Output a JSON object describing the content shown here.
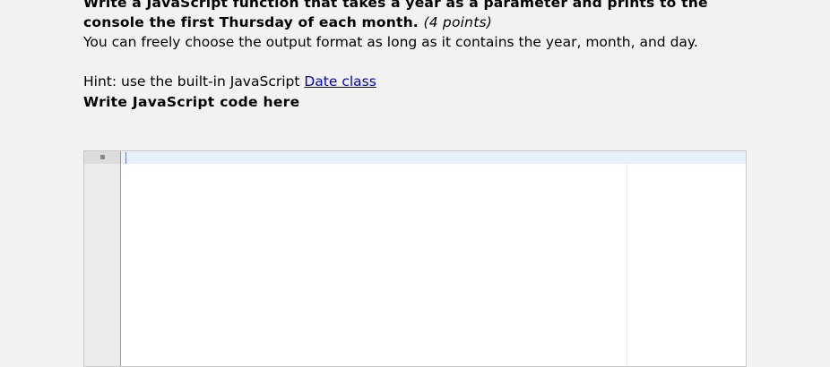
{
  "question": {
    "title": "Write a JavaScript function that takes a year as a parameter and prints to the console the first Thursday of each month.",
    "points": "(4 points)",
    "description": "You can freely choose the output format as long as it contains the year, month, and day.",
    "hint_prefix": "Hint: use the built-in JavaScript ",
    "hint_link": "Date class",
    "code_label": "Write JavaScript code here"
  },
  "editor": {
    "content": ""
  }
}
